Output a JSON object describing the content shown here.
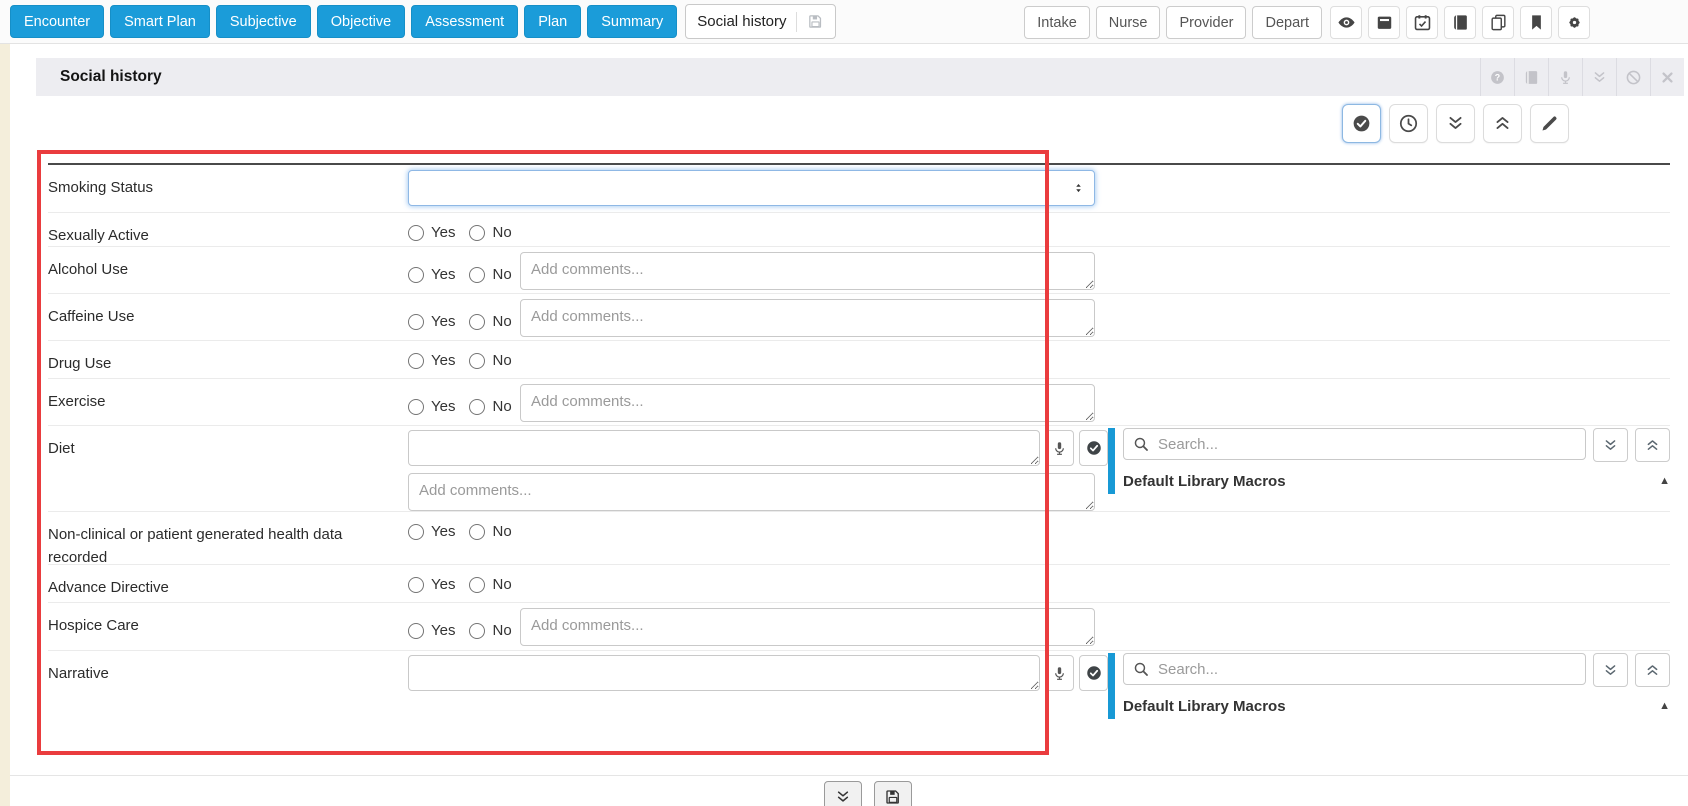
{
  "topbar": {
    "nav": [
      "Encounter",
      "Smart Plan",
      "Subjective",
      "Objective",
      "Assessment",
      "Plan",
      "Summary"
    ],
    "active_tab": {
      "label": "Social history",
      "icon": "save-icon"
    },
    "right_nav": [
      "Intake",
      "Nurse",
      "Provider",
      "Depart"
    ],
    "icon_buttons": [
      "eye-icon",
      "archive-icon",
      "calendar-check-icon",
      "book-icon",
      "copy-icon",
      "bookmark-icon",
      "gear-icon"
    ]
  },
  "panel": {
    "title": "Social history",
    "header_icons": [
      "help-icon",
      "book-icon",
      "mic-icon",
      "chevron-double-down-icon",
      "block-icon",
      "close-icon"
    ],
    "action_icons": [
      "check-circle-icon",
      "clock-icon",
      "chevron-double-down-icon",
      "chevron-double-up-icon",
      "pencil-icon"
    ]
  },
  "form": {
    "yes_label": "Yes",
    "no_label": "No",
    "comments_placeholder": "Add comments...",
    "rows": [
      {
        "label": "Smoking Status",
        "type": "select",
        "value": ""
      },
      {
        "label": "Sexually Active",
        "type": "yesno"
      },
      {
        "label": "Alcohol Use",
        "type": "yesno_comments",
        "comments_value": ""
      },
      {
        "label": "Caffeine Use",
        "type": "yesno_comments",
        "comments_value": ""
      },
      {
        "label": "Drug Use",
        "type": "yesno"
      },
      {
        "label": "Exercise",
        "type": "yesno_comments",
        "comments_value": ""
      },
      {
        "label": "Diet",
        "type": "text_macros",
        "value": "",
        "comments_row": true,
        "comments_value": ""
      },
      {
        "label": "Non-clinical or patient generated health data recorded",
        "type": "yesno"
      },
      {
        "label": "Advance Directive",
        "type": "yesno"
      },
      {
        "label": "Hospice Care",
        "type": "yesno_comments",
        "comments_value": ""
      },
      {
        "label": "Narrative",
        "type": "text_macros",
        "value": "",
        "comments_row": false
      }
    ]
  },
  "macros": {
    "search_placeholder": "Search...",
    "search_value": "",
    "header": "Default Library Macros",
    "collapse_icon": "triangle-up-icon"
  },
  "bottom": {
    "icons": [
      "chevron-double-down-icon",
      "save-icon"
    ]
  },
  "colors": {
    "accent_blue": "#1b9cd9",
    "macro_bar_blue": "#1899d5",
    "highlight_red": "#ea3c3e",
    "panel_header_bg": "#ededf1",
    "cream_strip": "#f4eedb"
  }
}
